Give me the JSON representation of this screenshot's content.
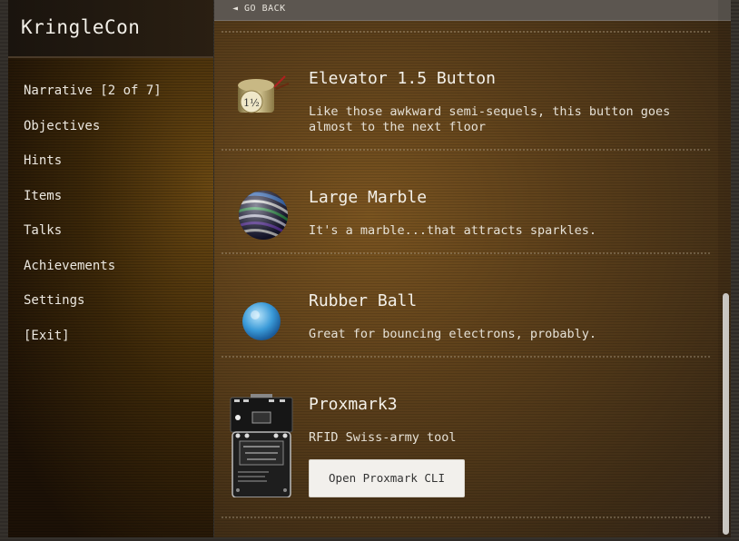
{
  "app": {
    "title": "KringleCon"
  },
  "sidebar": {
    "items": [
      {
        "label": "Narrative [2 of 7]"
      },
      {
        "label": "Objectives"
      },
      {
        "label": "Hints"
      },
      {
        "label": "Items"
      },
      {
        "label": "Talks"
      },
      {
        "label": "Achievements"
      },
      {
        "label": "Settings"
      },
      {
        "label": "[Exit]"
      }
    ]
  },
  "topbar": {
    "back_label": "◄ GO BACK"
  },
  "inventory": {
    "items": [
      {
        "name": "Elevator 1.5 Button",
        "description": "Like those awkward semi-sequels, this button goes almost to the next floor",
        "icon": "elevator-button-icon",
        "icon_text": "1½"
      },
      {
        "name": "Large Marble",
        "description": "It's a marble...that attracts sparkles.",
        "icon": "marble-icon"
      },
      {
        "name": "Rubber Ball",
        "description": "Great for bouncing electrons, probably.",
        "icon": "rubber-ball-icon"
      },
      {
        "name": "Proxmark3",
        "description": "RFID Swiss-army tool",
        "icon": "proxmark-device-icon",
        "button_label": "Open Proxmark CLI"
      }
    ]
  },
  "scroll": {
    "position_fraction": 0.55
  },
  "colors": {
    "sidebar_glow": "#6a4812",
    "main_glow": "#7a5420",
    "text": "#f4f1ea",
    "button_bg": "#f2f0ec"
  }
}
